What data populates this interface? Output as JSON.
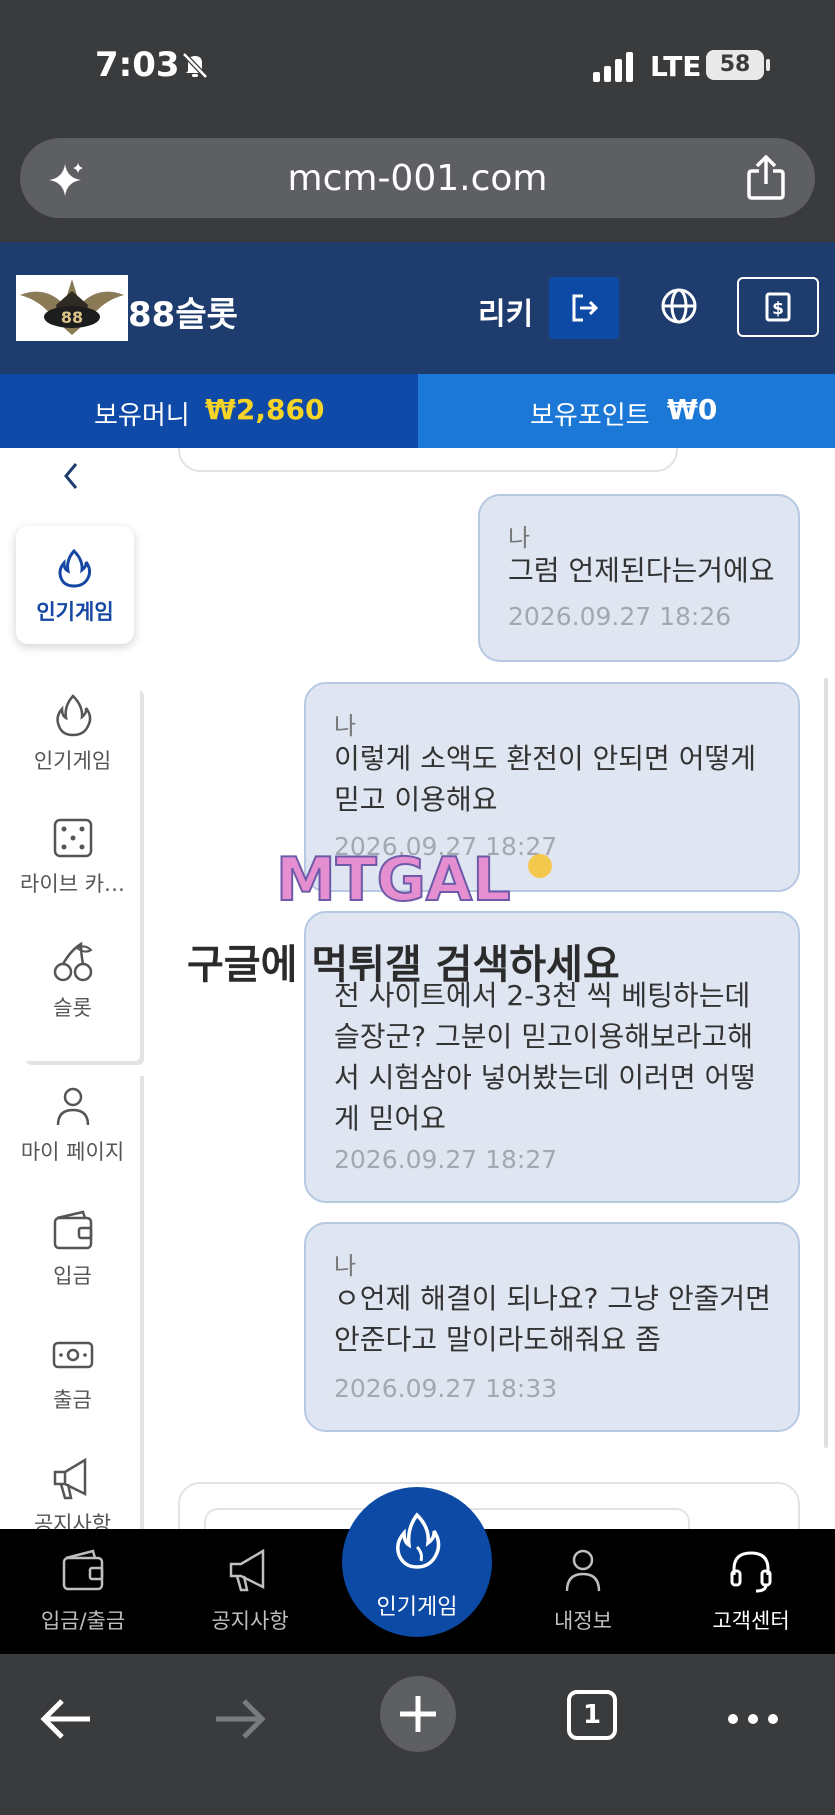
{
  "status_bar": {
    "time": "7:03",
    "network": "LTE",
    "battery": "58"
  },
  "browser": {
    "url": "mcm-001.com",
    "tab_count": "1"
  },
  "header": {
    "site_name": "88슬롯",
    "username": "리키",
    "brand_color": "#1f3c6e",
    "accent_color": "#0d4aa6"
  },
  "balance": {
    "money_label": "보유머니",
    "money_value": "₩2,860",
    "points_label": "보유포인트",
    "points_value": "₩0",
    "money_value_color": "#f5d327"
  },
  "sidebar": {
    "active_item": {
      "label": "인기게임",
      "icon": "fire-icon"
    },
    "items": [
      {
        "label": "인기게임",
        "icon": "fire-icon"
      },
      {
        "label": "라이브 카…",
        "icon": "dice-icon"
      },
      {
        "label": "슬롯",
        "icon": "cherry-icon"
      },
      {
        "label": "마이 페이지",
        "icon": "user-icon"
      },
      {
        "label": "입금",
        "icon": "wallet-icon"
      },
      {
        "label": "출금",
        "icon": "cash-icon"
      },
      {
        "label": "공지사항",
        "icon": "megaphone-icon"
      }
    ]
  },
  "messages": [
    {
      "sender": "나",
      "text": "그럼 언제된다는거에요",
      "time": "2026.09.27 18:26"
    },
    {
      "sender": "나",
      "text": "이렇게 소액도 환전이 안되면 어떻게 믿고 이용해요",
      "time": "2026.09.27 18:27"
    },
    {
      "sender": "",
      "text": "전 사이트에서 2-3천 씩 베팅하는데 슬장군? 그분이 믿고이용해보라고해서 시험삼아 넣어봤는데 이러면 어떻게 믿어요",
      "time": "2026.09.27 18:27"
    },
    {
      "sender": "나",
      "text": "ㅇ언제 해결이 되나요? 그냥 안줄거면 안준다고 말이라도해줘요 좀",
      "time": "2026.09.27 18:33"
    }
  ],
  "watermark": {
    "logo_text": "MTGAL",
    "text": "구글에 먹튀갤 검색하세요"
  },
  "bottom_nav": {
    "items": [
      {
        "label": "입금/출금",
        "icon": "wallet-icon"
      },
      {
        "label": "공지사항",
        "icon": "megaphone-icon"
      },
      {
        "label": "인기게임",
        "icon": "fire-icon"
      },
      {
        "label": "내정보",
        "icon": "user-icon"
      },
      {
        "label": "고객센터",
        "icon": "headset-icon"
      }
    ]
  }
}
